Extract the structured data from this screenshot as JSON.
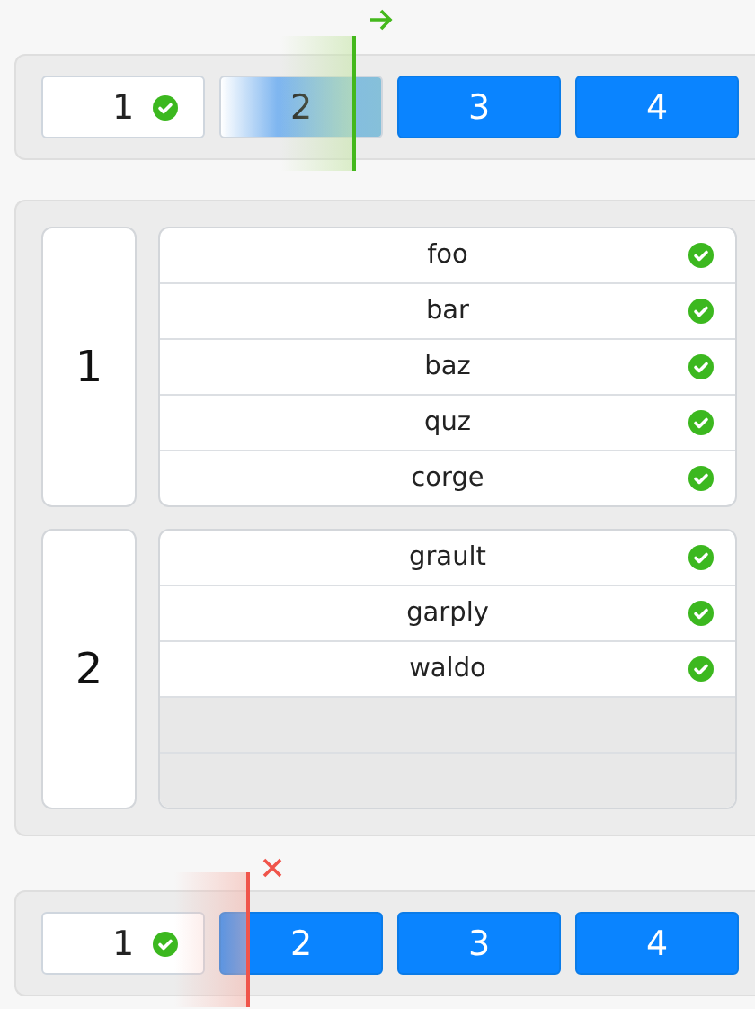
{
  "top_stepper": {
    "swipe_accepted": true,
    "steps": [
      {
        "label": "1",
        "kind": "done"
      },
      {
        "label": "2",
        "kind": "partial"
      },
      {
        "label": "3",
        "kind": "todo"
      },
      {
        "label": "4",
        "kind": "todo"
      }
    ]
  },
  "groups": [
    {
      "number": "1",
      "rows": [
        {
          "kind": "item",
          "label": "foo",
          "checked": true
        },
        {
          "kind": "item",
          "label": "bar",
          "checked": true
        },
        {
          "kind": "item",
          "label": "baz",
          "checked": true
        },
        {
          "kind": "item",
          "label": "quz",
          "checked": true
        },
        {
          "kind": "item",
          "label": "corge",
          "checked": true
        }
      ]
    },
    {
      "number": "2",
      "rows": [
        {
          "kind": "item",
          "label": "grault",
          "checked": true
        },
        {
          "kind": "item",
          "label": "garply",
          "checked": true
        },
        {
          "kind": "item",
          "label": "waldo",
          "checked": true
        },
        {
          "kind": "empty"
        },
        {
          "kind": "empty"
        }
      ]
    }
  ],
  "bottom_stepper": {
    "swipe_accepted": false,
    "steps": [
      {
        "label": "1",
        "kind": "done"
      },
      {
        "label": "2",
        "kind": "todo"
      },
      {
        "label": "3",
        "kind": "todo"
      },
      {
        "label": "4",
        "kind": "todo"
      }
    ]
  }
}
